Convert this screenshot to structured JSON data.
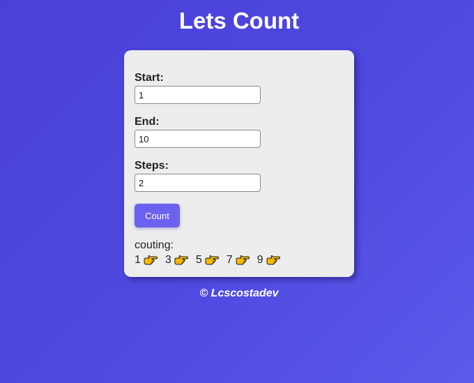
{
  "header": {
    "title": "Lets Count"
  },
  "form": {
    "start": {
      "label": "Start:",
      "value": "1"
    },
    "end": {
      "label": "End:",
      "value": "10"
    },
    "steps": {
      "label": "Steps:",
      "value": "2"
    },
    "button_label": "Count"
  },
  "result": {
    "label": "couting:",
    "numbers": [
      "1",
      "3",
      "5",
      "7",
      "9"
    ],
    "separator_icon": "backhand-index-pointing-right-icon"
  },
  "footer": {
    "text": "© Lcscostadev"
  },
  "colors": {
    "accent": "#6c62f0",
    "card_background": "#ededed",
    "hand_fill": "#f5b800"
  }
}
